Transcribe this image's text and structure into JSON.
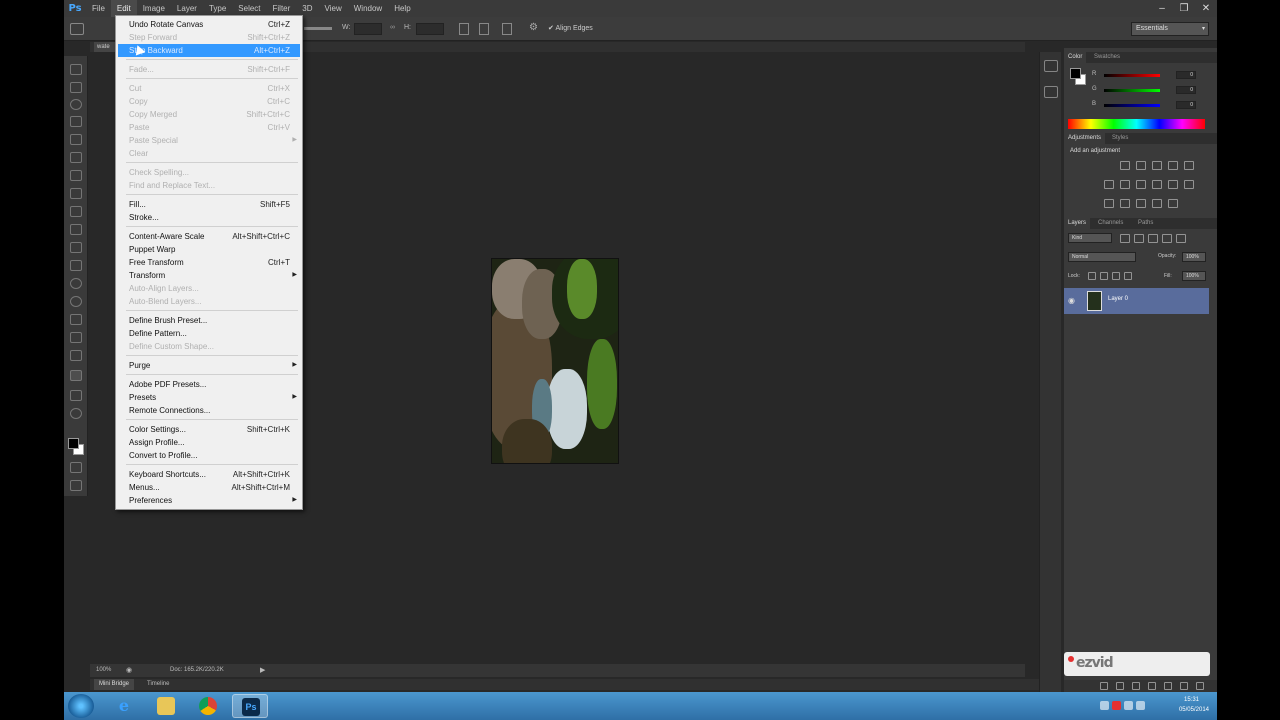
{
  "app": {
    "logo": "Ps",
    "minimize": "–",
    "restore": "❐",
    "close": "✕"
  },
  "menubar": [
    "File",
    "Edit",
    "Image",
    "Layer",
    "Type",
    "Select",
    "Filter",
    "3D",
    "View",
    "Window",
    "Help"
  ],
  "options_bar": {
    "width_label": "W:",
    "link_icon": "link-icon",
    "height_label": "H:",
    "align_edges_label": "Align Edges",
    "workspace": "Essentials"
  },
  "document_tab": {
    "label": "wate"
  },
  "edit_menu": {
    "items": [
      {
        "label": "Undo Rotate Canvas",
        "shortcut": "Ctrl+Z",
        "state": "enabled"
      },
      {
        "label": "Step Forward",
        "shortcut": "Shift+Ctrl+Z",
        "state": "disabled"
      },
      {
        "label": "Step Backward",
        "shortcut": "Alt+Ctrl+Z",
        "state": "selected"
      },
      {
        "separator": true
      },
      {
        "label": "Fade...",
        "shortcut": "Shift+Ctrl+F",
        "state": "disabled"
      },
      {
        "separator": true
      },
      {
        "label": "Cut",
        "shortcut": "Ctrl+X",
        "state": "disabled"
      },
      {
        "label": "Copy",
        "shortcut": "Ctrl+C",
        "state": "disabled"
      },
      {
        "label": "Copy Merged",
        "shortcut": "Shift+Ctrl+C",
        "state": "disabled"
      },
      {
        "label": "Paste",
        "shortcut": "Ctrl+V",
        "state": "disabled"
      },
      {
        "label": "Paste Special",
        "shortcut": "",
        "state": "disabled",
        "submenu": true
      },
      {
        "label": "Clear",
        "shortcut": "",
        "state": "disabled"
      },
      {
        "separator": true
      },
      {
        "label": "Check Spelling...",
        "shortcut": "",
        "state": "disabled"
      },
      {
        "label": "Find and Replace Text...",
        "shortcut": "",
        "state": "disabled"
      },
      {
        "separator": true
      },
      {
        "label": "Fill...",
        "shortcut": "Shift+F5",
        "state": "enabled"
      },
      {
        "label": "Stroke...",
        "shortcut": "",
        "state": "enabled"
      },
      {
        "separator": true
      },
      {
        "label": "Content-Aware Scale",
        "shortcut": "Alt+Shift+Ctrl+C",
        "state": "enabled"
      },
      {
        "label": "Puppet Warp",
        "shortcut": "",
        "state": "enabled"
      },
      {
        "label": "Free Transform",
        "shortcut": "Ctrl+T",
        "state": "enabled"
      },
      {
        "label": "Transform",
        "shortcut": "",
        "state": "enabled",
        "submenu": true
      },
      {
        "label": "Auto-Align Layers...",
        "shortcut": "",
        "state": "disabled"
      },
      {
        "label": "Auto-Blend Layers...",
        "shortcut": "",
        "state": "disabled"
      },
      {
        "separator": true
      },
      {
        "label": "Define Brush Preset...",
        "shortcut": "",
        "state": "enabled"
      },
      {
        "label": "Define Pattern...",
        "shortcut": "",
        "state": "enabled"
      },
      {
        "label": "Define Custom Shape...",
        "shortcut": "",
        "state": "disabled"
      },
      {
        "separator": true
      },
      {
        "label": "Purge",
        "shortcut": "",
        "state": "enabled",
        "submenu": true
      },
      {
        "separator": true
      },
      {
        "label": "Adobe PDF Presets...",
        "shortcut": "",
        "state": "enabled"
      },
      {
        "label": "Presets",
        "shortcut": "",
        "state": "enabled",
        "submenu": true
      },
      {
        "label": "Remote Connections...",
        "shortcut": "",
        "state": "enabled"
      },
      {
        "separator": true
      },
      {
        "label": "Color Settings...",
        "shortcut": "Shift+Ctrl+K",
        "state": "enabled"
      },
      {
        "label": "Assign Profile...",
        "shortcut": "",
        "state": "enabled"
      },
      {
        "label": "Convert to Profile...",
        "shortcut": "",
        "state": "enabled"
      },
      {
        "separator": true
      },
      {
        "label": "Keyboard Shortcuts...",
        "shortcut": "Alt+Shift+Ctrl+K",
        "state": "enabled"
      },
      {
        "label": "Menus...",
        "shortcut": "Alt+Shift+Ctrl+M",
        "state": "enabled"
      },
      {
        "label": "Preferences",
        "shortcut": "",
        "state": "enabled",
        "submenu": true
      }
    ]
  },
  "status_bar": {
    "zoom": "100%",
    "doc_info": "Doc: 165.2K/220.2K",
    "arrow": "▶"
  },
  "bottom_tabs": {
    "mini_bridge": "Mini Bridge",
    "timeline": "Timeline"
  },
  "color_panel": {
    "tabs": [
      "Color",
      "Swatches"
    ],
    "r_label": "R",
    "g_label": "G",
    "b_label": "B",
    "r_value": "0",
    "g_value": "0",
    "b_value": "0"
  },
  "adjustments_panel": {
    "tabs": [
      "Adjustments",
      "Styles"
    ],
    "title": "Add an adjustment"
  },
  "layers_panel": {
    "tabs": [
      "Layers",
      "Channels",
      "Paths"
    ],
    "filter": "Kind",
    "blend_mode": "Normal",
    "opacity_label": "Opacity:",
    "opacity_value": "100%",
    "lock_label": "Lock:",
    "fill_label": "Fill:",
    "fill_value": "100%",
    "layers": [
      {
        "name": "Layer 0",
        "visible": true,
        "selected": true
      }
    ]
  },
  "watermark": {
    "text": "ezvid"
  },
  "taskbar": {
    "apps": [
      {
        "name": "internet-explorer",
        "glyph": "e"
      },
      {
        "name": "file-explorer",
        "glyph": ""
      },
      {
        "name": "chrome",
        "glyph": ""
      },
      {
        "name": "photoshop",
        "glyph": "Ps",
        "active": true
      }
    ],
    "time": "15:31",
    "date": "05/05/2014"
  },
  "colors": {
    "selected_highlight": "#3399ff",
    "layer_selected": "#596c9c",
    "ps_blue": "#49a9ff"
  }
}
